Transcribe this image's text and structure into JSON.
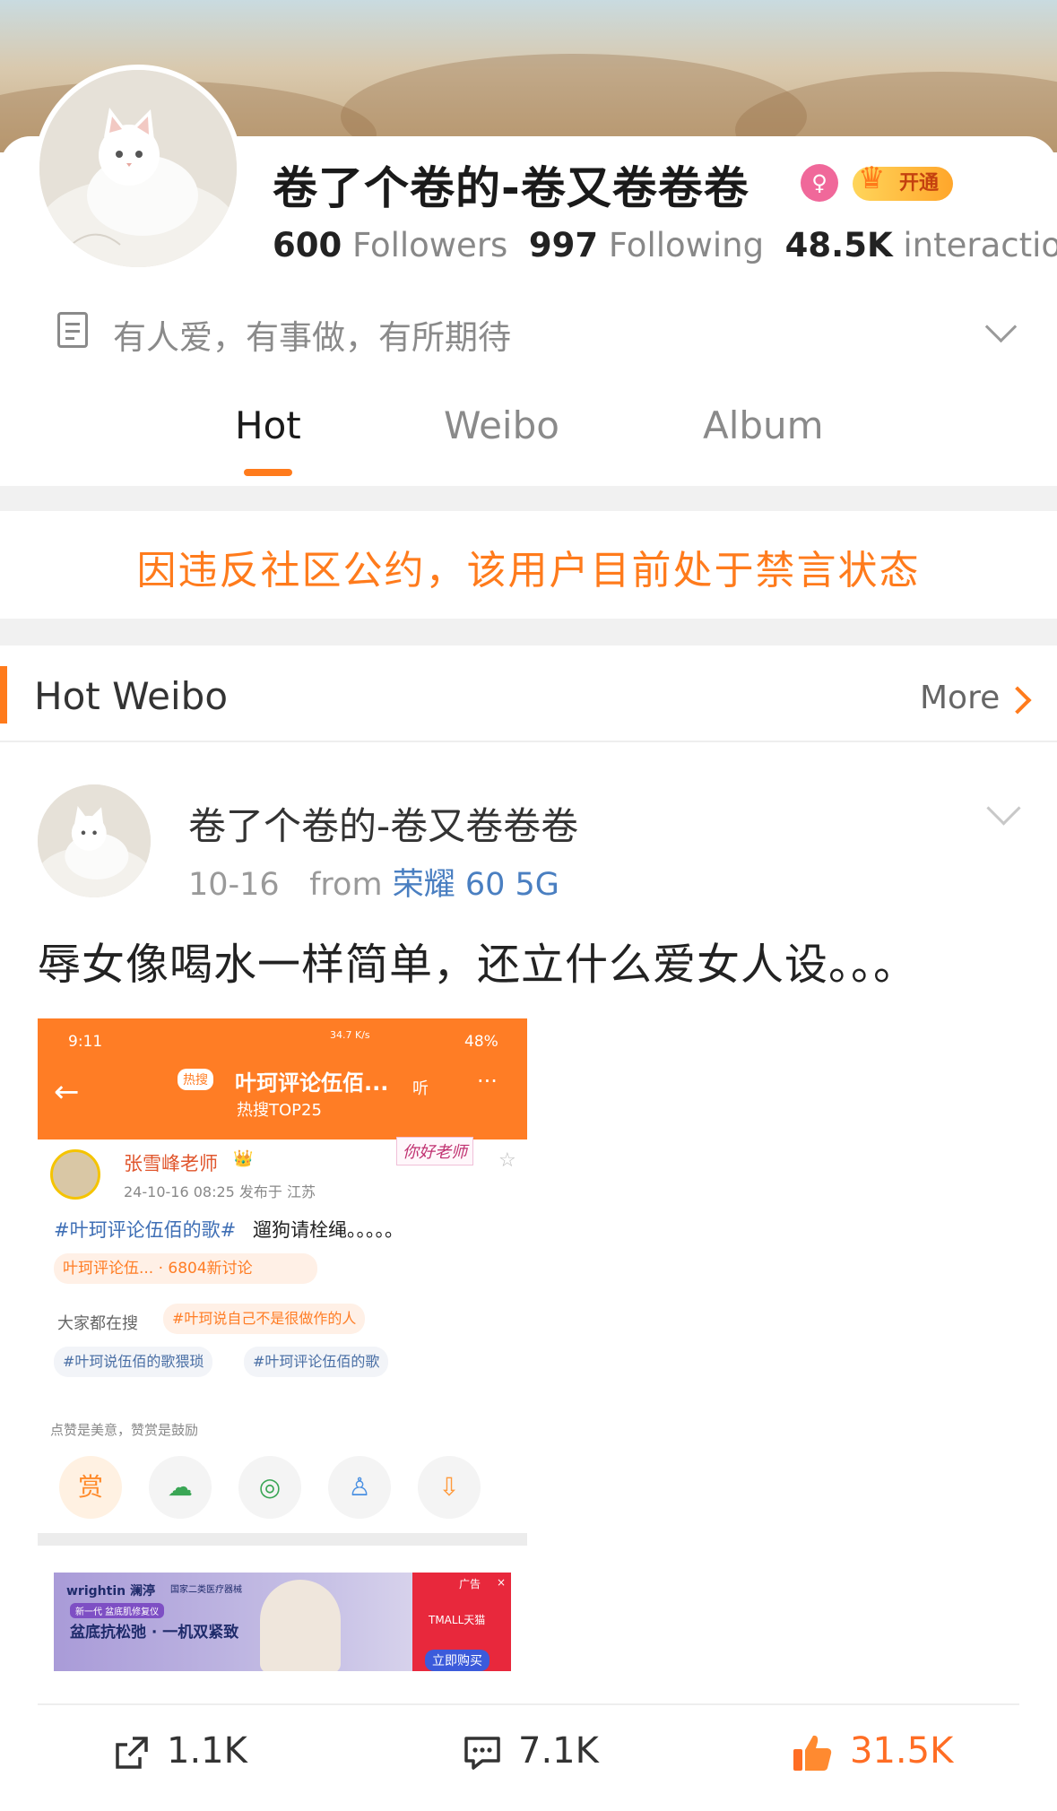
{
  "profile": {
    "name": "卷了个卷的-卷又卷卷卷",
    "vip_badge": "开通",
    "followers_count": "600",
    "followers_label": "Followers",
    "following_count": "997",
    "following_label": "Following",
    "interaction_count": "48.5K",
    "interaction_label": "interaction",
    "bio": "有人爱，有事做，有所期待"
  },
  "tabs": [
    {
      "label": "Hot",
      "active": true
    },
    {
      "label": "Weibo",
      "active": false
    },
    {
      "label": "Album",
      "active": false
    }
  ],
  "notice": "因违反社区公约，该用户目前处于禁言状态",
  "hot_section": {
    "title": "Hot Weibo",
    "more_label": "More"
  },
  "post": {
    "author": "卷了个卷的-卷又卷卷卷",
    "date": "10-16",
    "from_label": "from",
    "source": "荣耀 60 5G",
    "text": "辱女像喝水一样简单，还立什么爱女人设。。。",
    "embedded_screenshot": {
      "time": "9:11",
      "status": "34.7 K/s",
      "battery": "48%",
      "hot_tag": "热搜",
      "title": "叶珂评论伍佰...",
      "subtitle": "热搜TOP25",
      "listen": "听",
      "author": "张雪峰老师",
      "sticker": "你好老师",
      "meta": "24-10-16 08:25  发布于 江苏",
      "body_tag": "#叶珂评论伍佰的歌#",
      "body_text": "遛狗请栓绳。。。。。",
      "hot_pill": "叶珂评论伍... · 6804新讨论",
      "search_label": "大家都在搜",
      "tags": [
        "#叶珂说自己不是很做作的人",
        "#叶珂说伍佰的歌猥琐",
        "#叶珂评论伍佰的歌"
      ],
      "reward_hint": "点赞是美意，赞赏是鼓励",
      "reward_label": "赏",
      "ad": {
        "brand": "wrightin 澜渟",
        "brand_note": "国家二类医疗器械",
        "tagline": "新一代 盆底肌修复仪",
        "headline": "盆底抗松弛 · 一机双紧致",
        "ad_label": "广告",
        "store": "TMALL天猫",
        "cta": "立即购买"
      }
    },
    "reposts": "1.1K",
    "comments": "7.1K",
    "likes": "31.5K"
  },
  "colors": {
    "accent": "#ff7b1c",
    "link": "#4a7fc1",
    "muted": "#8a8a8a"
  }
}
